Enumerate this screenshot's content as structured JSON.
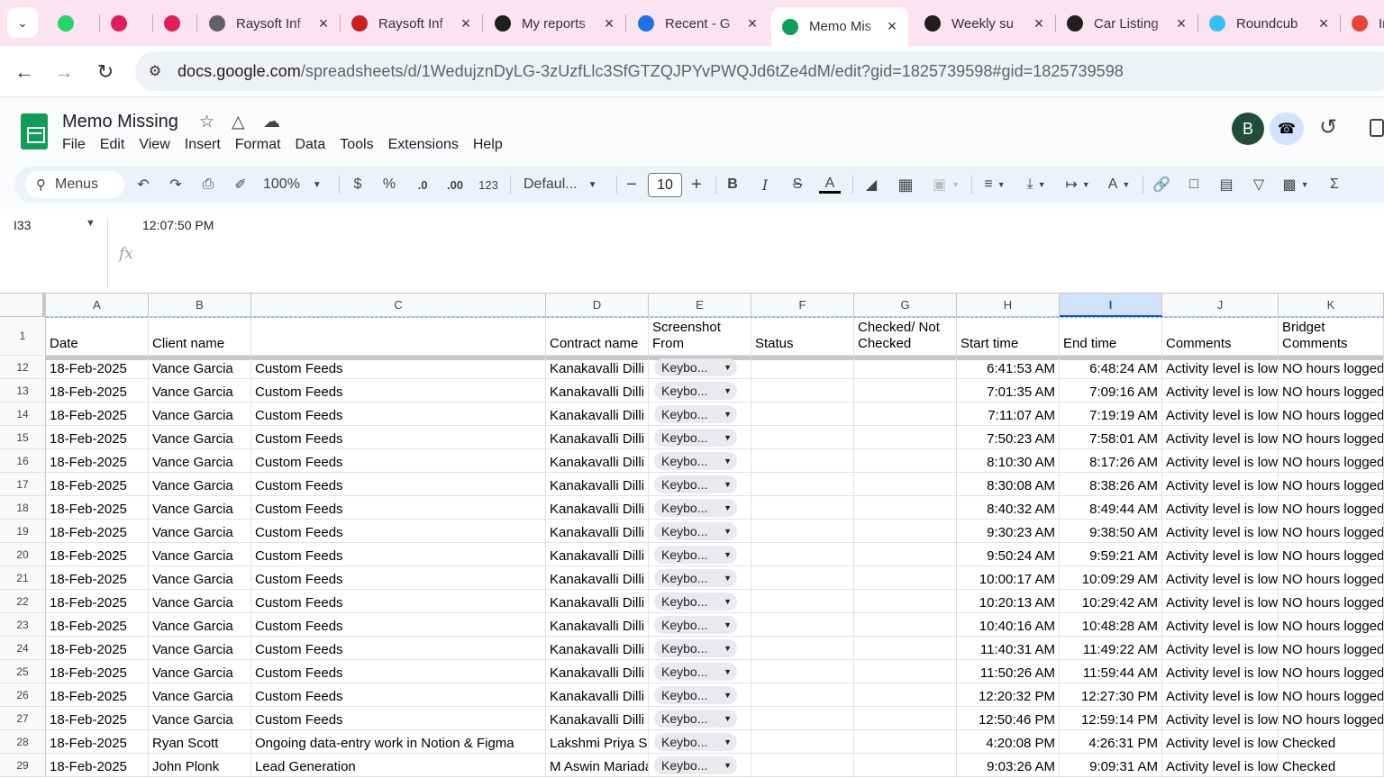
{
  "browser": {
    "tabs": [
      {
        "title": "",
        "icon": "whatsapp-icon",
        "color": "#25d366"
      },
      {
        "title": "",
        "icon": "slack-icon",
        "color": "#e01e5a"
      },
      {
        "title": "",
        "icon": "slack-icon",
        "color": "#e01e5a"
      },
      {
        "title": "Raysoft Inf",
        "icon": "globe-icon",
        "color": "#5f6368"
      },
      {
        "title": "Raysoft Inf",
        "icon": "presentation-icon",
        "color": "#c5221f"
      },
      {
        "title": "My reports",
        "icon": "upwork-icon",
        "color": "#1f1f1f"
      },
      {
        "title": "Recent - G",
        "icon": "drive-icon",
        "color": "#1a73e8"
      },
      {
        "title": "Memo Mis",
        "icon": "sheets-icon",
        "color": "#0f9d58"
      },
      {
        "title": "Weekly su",
        "icon": "upwork-icon",
        "color": "#1f1f1f"
      },
      {
        "title": "Car Listing",
        "icon": "upwork-icon",
        "color": "#1f1f1f"
      },
      {
        "title": "Roundcub",
        "icon": "roundcube-icon",
        "color": "#37beff"
      },
      {
        "title": "In",
        "icon": "gmail-icon",
        "color": "#ea4335"
      }
    ],
    "url_host": "docs.google.com",
    "url_path": "/spreadsheets/d/1WedujznDyLG-3zUzfLlc3SfGTZQJPYvPWQJd6tZe4dM/edit?gid=1825739598#gid=1825739598"
  },
  "doc": {
    "title": "Memo Missing",
    "menus": [
      "File",
      "Edit",
      "View",
      "Insert",
      "Format",
      "Data",
      "Tools",
      "Extensions",
      "Help"
    ],
    "avatar_letter": "B"
  },
  "toolbar": {
    "menus_label": "Menus",
    "zoom": "100%",
    "currency": "$",
    "percent": "%",
    "dec_decrease": ".0",
    "dec_increase": ".00",
    "number_format": "123",
    "font": "Defaul...",
    "font_size": "10"
  },
  "formula_bar": {
    "cell_ref": "I33",
    "value": "12:07:50 PM",
    "fx": "fx"
  },
  "grid": {
    "columns": [
      "A",
      "B",
      "C",
      "D",
      "E",
      "F",
      "G",
      "H",
      "I",
      "J",
      "K"
    ],
    "selected_column": "I",
    "header_row_number": "1",
    "header": [
      "Date",
      "Client name",
      "",
      "Contract name",
      "Screenshot From",
      "Status",
      "Checked/ Not Checked",
      "Start time",
      "End time",
      "Comments",
      "Bridget Comments"
    ],
    "rows": [
      {
        "n": "12",
        "date": "18-Feb-2025",
        "client": "Vance Garcia",
        "c": "Custom Feeds",
        "contract": "Kanakavalli Dilli",
        "shot": "Keybo...",
        "start": "6:41:53 AM",
        "end": "6:48:24 AM",
        "comments": "Activity level is low",
        "bridget": "NO hours logged"
      },
      {
        "n": "13",
        "date": "18-Feb-2025",
        "client": "Vance Garcia",
        "c": "Custom Feeds",
        "contract": "Kanakavalli Dilli",
        "shot": "Keybo...",
        "start": "7:01:35 AM",
        "end": "7:09:16 AM",
        "comments": "Activity level is low",
        "bridget": "NO hours logged"
      },
      {
        "n": "14",
        "date": "18-Feb-2025",
        "client": "Vance Garcia",
        "c": "Custom Feeds",
        "contract": "Kanakavalli Dilli",
        "shot": "Keybo...",
        "start": "7:11:07 AM",
        "end": "7:19:19 AM",
        "comments": "Activity level is low",
        "bridget": "NO hours logged"
      },
      {
        "n": "15",
        "date": "18-Feb-2025",
        "client": "Vance Garcia",
        "c": "Custom Feeds",
        "contract": "Kanakavalli Dilli",
        "shot": "Keybo...",
        "start": "7:50:23 AM",
        "end": "7:58:01 AM",
        "comments": "Activity level is low",
        "bridget": "NO hours logged"
      },
      {
        "n": "16",
        "date": "18-Feb-2025",
        "client": "Vance Garcia",
        "c": "Custom Feeds",
        "contract": "Kanakavalli Dilli",
        "shot": "Keybo...",
        "start": "8:10:30 AM",
        "end": "8:17:26 AM",
        "comments": "Activity level is low",
        "bridget": "NO hours logged"
      },
      {
        "n": "17",
        "date": "18-Feb-2025",
        "client": "Vance Garcia",
        "c": "Custom Feeds",
        "contract": "Kanakavalli Dilli",
        "shot": "Keybo...",
        "start": "8:30:08 AM",
        "end": "8:38:26 AM",
        "comments": "Activity level is low",
        "bridget": "NO hours logged"
      },
      {
        "n": "18",
        "date": "18-Feb-2025",
        "client": "Vance Garcia",
        "c": "Custom Feeds",
        "contract": "Kanakavalli Dilli",
        "shot": "Keybo...",
        "start": "8:40:32 AM",
        "end": "8:49:44 AM",
        "comments": "Activity level is low",
        "bridget": "NO hours logged"
      },
      {
        "n": "19",
        "date": "18-Feb-2025",
        "client": "Vance Garcia",
        "c": "Custom Feeds",
        "contract": "Kanakavalli Dilli",
        "shot": "Keybo...",
        "start": "9:30:23 AM",
        "end": "9:38:50 AM",
        "comments": "Activity level is low",
        "bridget": "NO hours logged"
      },
      {
        "n": "20",
        "date": "18-Feb-2025",
        "client": "Vance Garcia",
        "c": "Custom Feeds",
        "contract": "Kanakavalli Dilli",
        "shot": "Keybo...",
        "start": "9:50:24 AM",
        "end": "9:59:21 AM",
        "comments": "Activity level is low",
        "bridget": "NO hours logged"
      },
      {
        "n": "21",
        "date": "18-Feb-2025",
        "client": "Vance Garcia",
        "c": "Custom Feeds",
        "contract": "Kanakavalli Dilli",
        "shot": "Keybo...",
        "start": "10:00:17 AM",
        "end": "10:09:29 AM",
        "comments": "Activity level is low",
        "bridget": "NO hours logged"
      },
      {
        "n": "22",
        "date": "18-Feb-2025",
        "client": "Vance Garcia",
        "c": "Custom Feeds",
        "contract": "Kanakavalli Dilli",
        "shot": "Keybo...",
        "start": "10:20:13 AM",
        "end": "10:29:42 AM",
        "comments": "Activity level is low",
        "bridget": "NO hours logged"
      },
      {
        "n": "23",
        "date": "18-Feb-2025",
        "client": "Vance Garcia",
        "c": "Custom Feeds",
        "contract": "Kanakavalli Dilli",
        "shot": "Keybo...",
        "start": "10:40:16 AM",
        "end": "10:48:28 AM",
        "comments": "Activity level is low",
        "bridget": "NO hours logged"
      },
      {
        "n": "24",
        "date": "18-Feb-2025",
        "client": "Vance Garcia",
        "c": "Custom Feeds",
        "contract": "Kanakavalli Dilli",
        "shot": "Keybo...",
        "start": "11:40:31 AM",
        "end": "11:49:22 AM",
        "comments": "Activity level is low",
        "bridget": "NO hours logged"
      },
      {
        "n": "25",
        "date": "18-Feb-2025",
        "client": "Vance Garcia",
        "c": "Custom Feeds",
        "contract": "Kanakavalli Dilli",
        "shot": "Keybo...",
        "start": "11:50:26 AM",
        "end": "11:59:44 AM",
        "comments": "Activity level is low",
        "bridget": "NO hours logged"
      },
      {
        "n": "26",
        "date": "18-Feb-2025",
        "client": "Vance Garcia",
        "c": "Custom Feeds",
        "contract": "Kanakavalli Dilli",
        "shot": "Keybo...",
        "start": "12:20:32 PM",
        "end": "12:27:30 PM",
        "comments": "Activity level is low",
        "bridget": "NO hours logged"
      },
      {
        "n": "27",
        "date": "18-Feb-2025",
        "client": "Vance Garcia",
        "c": "Custom Feeds",
        "contract": "Kanakavalli Dilli",
        "shot": "Keybo...",
        "start": "12:50:46 PM",
        "end": "12:59:14 PM",
        "comments": "Activity level is low",
        "bridget": "NO hours logged"
      },
      {
        "n": "28",
        "date": "18-Feb-2025",
        "client": "Ryan Scott",
        "c": "Ongoing data-entry work in Notion & Figma",
        "contract": "Lakshmi Priya Sa",
        "shot": "Keybo...",
        "start": "4:20:08 PM",
        "end": "4:26:31 PM",
        "comments": "Activity level is low",
        "bridget": "Checked"
      },
      {
        "n": "29",
        "date": "18-Feb-2025",
        "client": "John Plonk",
        "c": "Lead Generation",
        "contract": "M Aswin Mariada",
        "shot": "Keybo...",
        "start": "9:03:26 AM",
        "end": "9:09:31 AM",
        "comments": "Activity level is low",
        "bridget": "Checked"
      }
    ]
  }
}
